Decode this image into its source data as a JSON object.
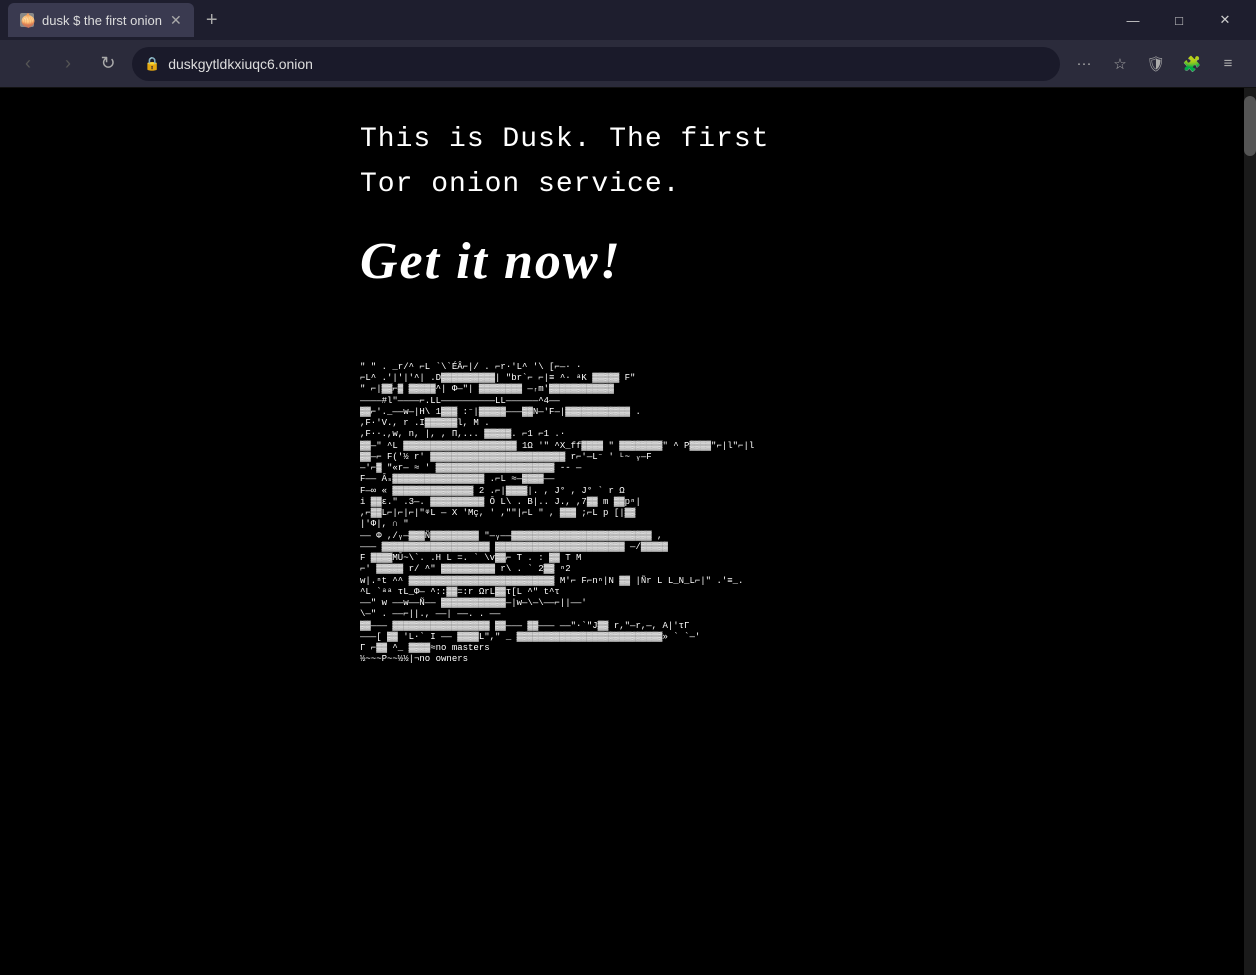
{
  "browser": {
    "tab": {
      "title": "dusk $ the first onion",
      "favicon": "🧅"
    },
    "address": "duskgytldkxiuqc6.onion",
    "address_icon": "🔒",
    "window_controls": {
      "minimize": "—",
      "maximize": "□",
      "close": "✕"
    },
    "nav": {
      "back": "‹",
      "forward": "›",
      "refresh": "↻"
    },
    "toolbar": {
      "menu": "···",
      "star": "☆",
      "shield": "🛡",
      "extensions": "🧩",
      "hamburger": "≡"
    }
  },
  "page": {
    "tagline_line1": "This is Dusk. The first",
    "tagline_line2": "Tor onion service.",
    "cta": "Get it now!",
    "bottom_text_1": "≈no masters",
    "bottom_text_2": "½~~~~P~~½½|¬no owners"
  }
}
